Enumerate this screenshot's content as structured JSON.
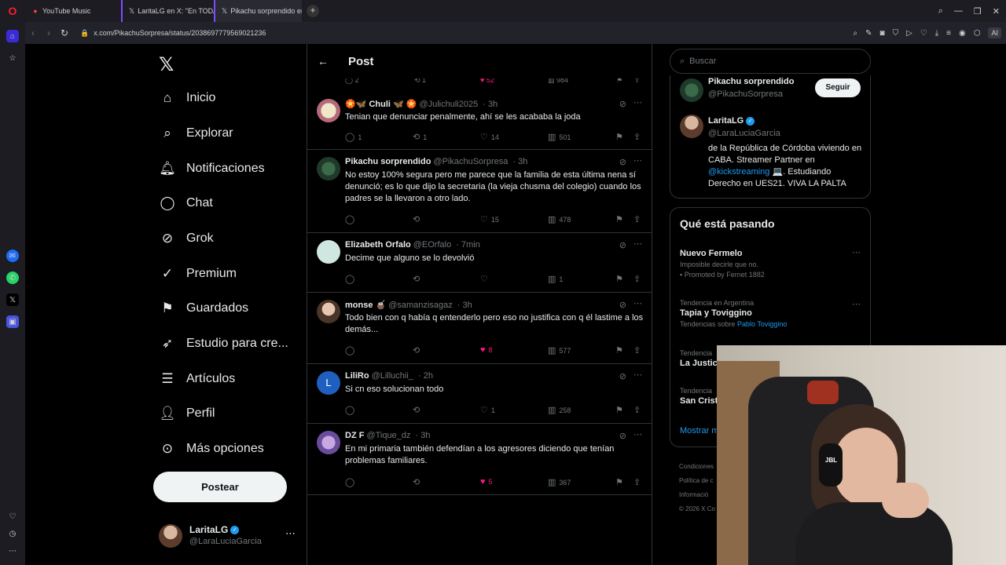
{
  "browser": {
    "tabs": [
      {
        "label": "YouTube Music",
        "icon": "youtube-music-icon"
      },
      {
        "label": "LaritaLG en X: \"En TODAS",
        "icon": "x-icon"
      },
      {
        "label": "Pikachu sorprendido en X",
        "icon": "x-icon"
      }
    ],
    "url": "x.com/PikachuSorpresa/status/2038697779569021236",
    "ai_label": "AI"
  },
  "sidebar": {
    "items": [
      {
        "label": "Inicio",
        "icon": "home-icon"
      },
      {
        "label": "Explorar",
        "icon": "search-icon"
      },
      {
        "label": "Notificaciones",
        "icon": "bell-icon"
      },
      {
        "label": "Chat",
        "icon": "chat-icon"
      },
      {
        "label": "Grok",
        "icon": "grok-icon"
      },
      {
        "label": "Premium",
        "icon": "premium-icon"
      },
      {
        "label": "Guardados",
        "icon": "bookmark-icon"
      },
      {
        "label": "Estudio para cre...",
        "icon": "rocket-icon"
      },
      {
        "label": "Artículos",
        "icon": "articles-icon"
      },
      {
        "label": "Perfil",
        "icon": "person-icon"
      },
      {
        "label": "Más opciones",
        "icon": "more-circle-icon"
      }
    ],
    "post_button": "Postear",
    "account": {
      "name": "LaritaLG",
      "handle": "@LaraLuciaGarcia"
    }
  },
  "main": {
    "title": "Post",
    "partial_actions": {
      "replies": "2",
      "reposts": "1",
      "likes": "52",
      "views": "984"
    },
    "tweets": [
      {
        "name": "🏵️🦋 Chuli 🦋 🏵️",
        "handle": "@Julichuli2025",
        "time": "· 3h",
        "text": "Tenian que denunciar penalmente, ahí se les acababa la joda",
        "replies": "1",
        "reposts": "1",
        "likes": "14",
        "views": "501",
        "liked": false
      },
      {
        "name": "Pikachu sorprendido",
        "handle": "@PikachuSorpresa",
        "time": "· 3h",
        "text": "No estoy 100% segura pero me parece que la familia de esta última nena sí denunció; es lo que dijo la secretaria (la vieja chusma del colegio) cuando los padres se la llevaron a otro lado.",
        "replies": "",
        "reposts": "",
        "likes": "15",
        "views": "478",
        "liked": false
      },
      {
        "name": "Elizabeth Orfalo",
        "handle": "@EOrfalo",
        "time": "· 7min",
        "text": "Decime que alguno se lo devolvió",
        "replies": "",
        "reposts": "",
        "likes": "",
        "views": "1",
        "liked": false
      },
      {
        "name": "monse 🧉",
        "handle": "@samanzisagaz",
        "time": "· 3h",
        "text": "Todo bien con q había q entenderlo pero eso no justifica con q él lastime a los demás...",
        "replies": "",
        "reposts": "",
        "likes": "8",
        "views": "577",
        "liked": true
      },
      {
        "name": "LiliRo",
        "handle": "@Lilluchii_",
        "time": "· 2h",
        "text": "Si cn eso solucionan todo",
        "replies": "",
        "reposts": "",
        "likes": "1",
        "views": "258",
        "liked": false
      },
      {
        "name": "DZ F",
        "handle": "@Tique_dz",
        "time": "· 3h",
        "text": "En mi primaria también defendían a los agresores diciendo que tenían problemas familiares.",
        "replies": "",
        "reposts": "",
        "likes": "5",
        "views": "367",
        "liked": true
      }
    ]
  },
  "right": {
    "search_placeholder": "Buscar",
    "profile_card": {
      "first": {
        "name": "Pikachu sorprendido",
        "handle": "@PikachuSorpresa",
        "follow": "Seguir"
      },
      "second": {
        "name": "LaritaLG",
        "handle": "@LaraLuciaGarcia",
        "bio_a": "de la República de Córdoba viviendo en CABA. Streamer Partner en ",
        "bio_link": "@kickstreaming",
        "bio_b": " 💻. Estudiando Derecho en UES21. VIVA LA PALTA"
      }
    },
    "trends": {
      "title": "Qué está pasando",
      "items": [
        {
          "meta": "",
          "name": "Nuevo Fermelo",
          "sub": "Imposible decirle que no.",
          "promoted": "Promoted by Fernet 1882"
        },
        {
          "meta": "Tendencia en Argentina",
          "name": "Tapia y Toviggino",
          "sub": "Tendencias sobre ",
          "sub_link": "Pablo Toviggino"
        },
        {
          "meta": "Tendencia",
          "name": "La Justici"
        },
        {
          "meta": "Tendencia",
          "name": "San Crist"
        }
      ],
      "show_more": "Mostrar m"
    },
    "footer": [
      "Condiciones",
      "Política de c",
      "Informació",
      "© 2026 X Co"
    ]
  }
}
